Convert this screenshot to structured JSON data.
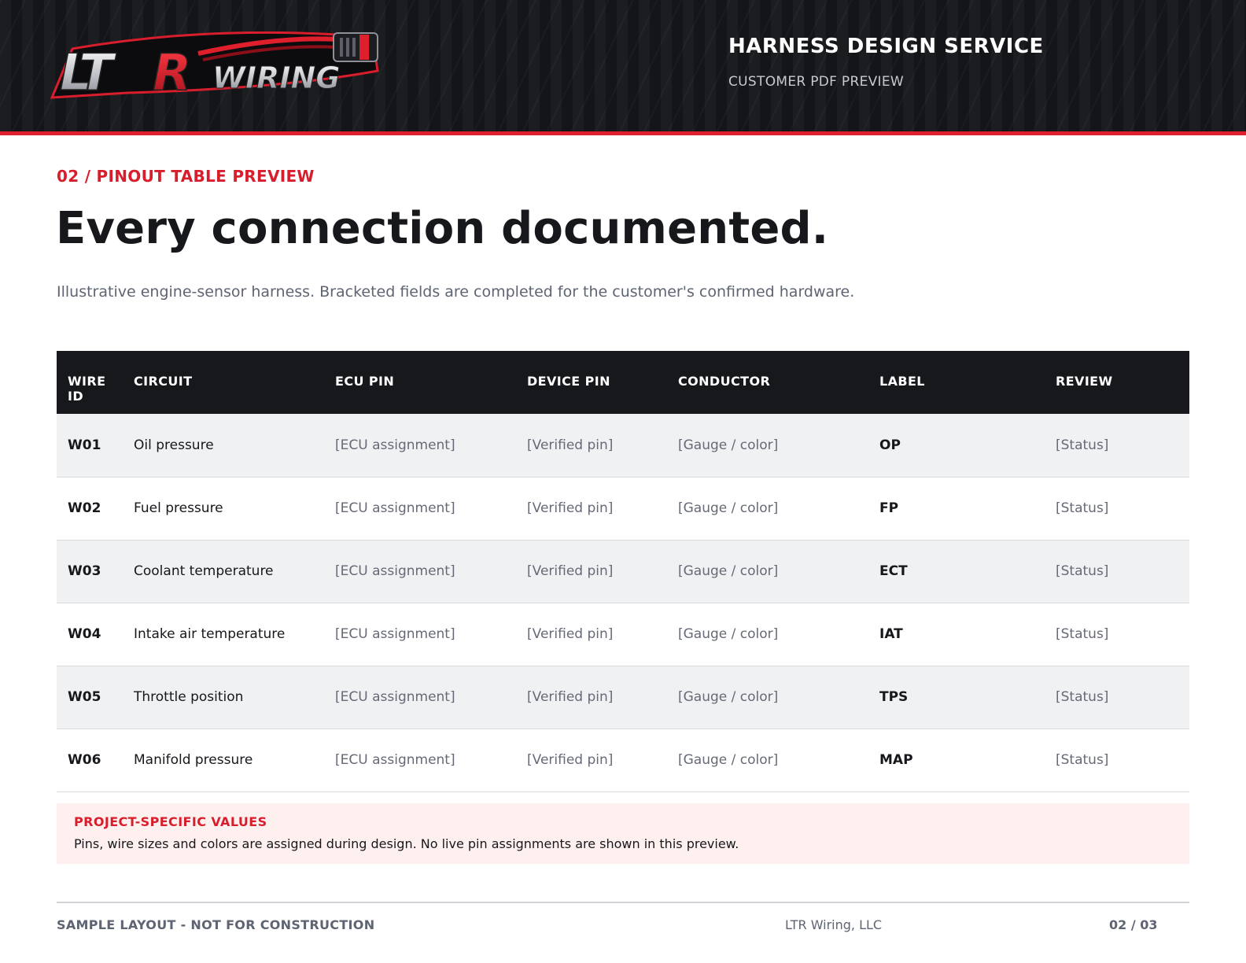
{
  "header": {
    "logo_text": "LTR WIRING",
    "title": "HARNESS DESIGN SERVICE",
    "subtitle": "CUSTOMER PDF PREVIEW"
  },
  "section": {
    "kicker": "02 / PINOUT TABLE PREVIEW",
    "headline": "Every connection documented.",
    "intro": "Illustrative engine-sensor harness. Bracketed fields are completed for the customer's confirmed hardware."
  },
  "table": {
    "columns": [
      "WIRE\nID",
      "CIRCUIT",
      "ECU PIN",
      "DEVICE PIN",
      "CONDUCTOR",
      "LABEL",
      "REVIEW"
    ],
    "rows": [
      {
        "wire_id": "W01",
        "circuit": "Oil pressure",
        "ecu_pin": "[ECU assignment]",
        "device_pin": "[Verified pin]",
        "conductor": "[Gauge / color]",
        "label": "OP",
        "review": "[Status]"
      },
      {
        "wire_id": "W02",
        "circuit": "Fuel pressure",
        "ecu_pin": "[ECU assignment]",
        "device_pin": "[Verified pin]",
        "conductor": "[Gauge / color]",
        "label": "FP",
        "review": "[Status]"
      },
      {
        "wire_id": "W03",
        "circuit": "Coolant temperature",
        "ecu_pin": "[ECU assignment]",
        "device_pin": "[Verified pin]",
        "conductor": "[Gauge / color]",
        "label": "ECT",
        "review": "[Status]"
      },
      {
        "wire_id": "W04",
        "circuit": "Intake air temperature",
        "ecu_pin": "[ECU assignment]",
        "device_pin": "[Verified pin]",
        "conductor": "[Gauge / color]",
        "label": "IAT",
        "review": "[Status]"
      },
      {
        "wire_id": "W05",
        "circuit": "Throttle position",
        "ecu_pin": "[ECU assignment]",
        "device_pin": "[Verified pin]",
        "conductor": "[Gauge / color]",
        "label": "TPS",
        "review": "[Status]"
      },
      {
        "wire_id": "W06",
        "circuit": "Manifold pressure",
        "ecu_pin": "[ECU assignment]",
        "device_pin": "[Verified pin]",
        "conductor": "[Gauge / color]",
        "label": "MAP",
        "review": "[Status]"
      }
    ]
  },
  "note": {
    "title": "PROJECT-SPECIFIC VALUES",
    "text": "Pins, wire sizes and colors are assigned during design. No live pin assignments are shown in this preview."
  },
  "footer": {
    "left": "SAMPLE LAYOUT - NOT FOR CONSTRUCTION",
    "center": "LTR Wiring, LLC",
    "page": "02 / 03"
  },
  "colors": {
    "accent": "#e01f2d",
    "header_bg": "#141518",
    "table_header_bg": "#17181c",
    "row_stripe": "#f0f1f3",
    "note_bg": "#fff0f0"
  }
}
